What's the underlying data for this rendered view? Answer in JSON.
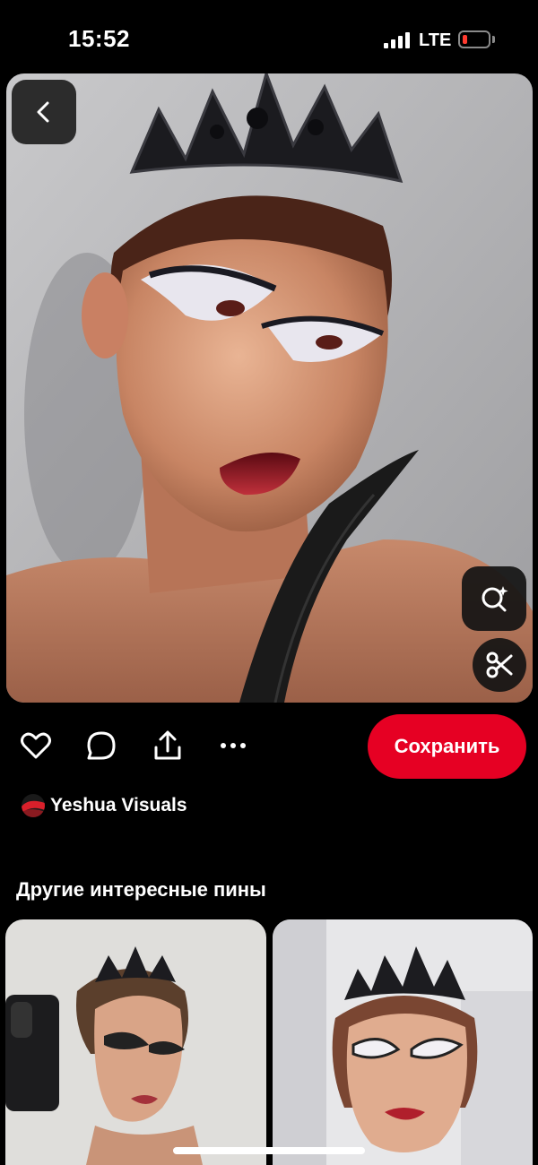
{
  "status_bar": {
    "time": "15:52",
    "network": "LTE",
    "battery_color": "#ff3b30"
  },
  "pin": {
    "image": {
      "description_icon": "photo",
      "accent": "#e60023"
    },
    "actions": {
      "save_label": "Сохранить"
    },
    "author": {
      "name": "Yeshua Visuals"
    }
  },
  "related": {
    "title": "Другие интересные пины"
  },
  "icons": {
    "back": "chevron-left-icon",
    "visual_search": "lens-search-icon",
    "cutout": "scissors-icon",
    "like": "heart-icon",
    "comment": "comment-icon",
    "share": "share-icon",
    "more": "more-icon"
  },
  "colors": {
    "save": "#e60023",
    "background": "#000000"
  }
}
